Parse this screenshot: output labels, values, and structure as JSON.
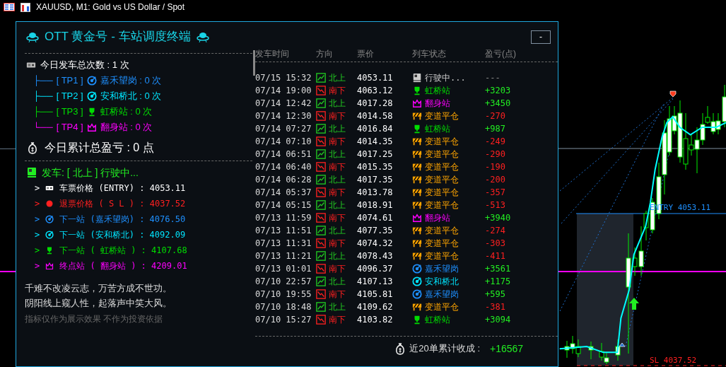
{
  "window": {
    "title": "XAUUSD, M1:  Gold vs US Dollar / Spot"
  },
  "panel": {
    "title": "OTT 黄金号 - 车站调度终端",
    "minimize": "-"
  },
  "summary": {
    "departures": "今日发车总次数 : 1 次",
    "branches": [
      {
        "tree": "├──",
        "tag": "[ TP1 ]",
        "station": "嘉禾望岗 : 0 次",
        "kind": "target",
        "color": "#1e90ff"
      },
      {
        "tree": "├──",
        "tag": "[ TP2 ]",
        "station": "安和桥北 : 0 次",
        "kind": "target",
        "color": "#00e5ff"
      },
      {
        "tree": "├──",
        "tag": "[ TP3 ]",
        "station": "虹桥站 : 0 次",
        "kind": "trophy",
        "color": "#00dd00"
      },
      {
        "tree": "└──",
        "tag": "[ TP4 ]",
        "station": "翻身站 : 0 次",
        "kind": "crown",
        "color": "#ff00ff"
      }
    ],
    "pnl": "今日累计总盈亏 : 0 点"
  },
  "current": {
    "status": "发车: [ 北上 ] 行驶中...",
    "lines": [
      {
        "marker": ">",
        "text": "车票价格 (ENTRY) : 4053.11",
        "kind": "ticket",
        "color": "#ffffff"
      },
      {
        "marker": ">",
        "text": "退票价格 ( S L ) : 4037.52",
        "kind": "dot",
        "color": "#ff2020"
      },
      {
        "marker": ">",
        "text": "下一站 (嘉禾望岗) : 4076.50",
        "kind": "target",
        "color": "#1e90ff"
      },
      {
        "marker": ">",
        "text": "下一站 (安和桥北) : 4092.09",
        "kind": "target",
        "color": "#00e5ff"
      },
      {
        "marker": ">",
        "text": "下一站 ( 虹桥站 ) : 4107.68",
        "kind": "trophy",
        "color": "#00dd00"
      },
      {
        "marker": ">",
        "text": "终点站 ( 翻身站 ) : 4209.01",
        "kind": "crown",
        "color": "#ff00ff"
      }
    ]
  },
  "quotes": [
    "千难不改凌云志，万苦方成不世功。",
    "阴阳线上窥人性，起落声中笑大风。"
  ],
  "disclaimer": "指标仅作为展示效果 不作为投资依据",
  "table": {
    "columns": [
      "发车时间",
      "方向",
      "票价",
      "列车状态",
      "盈亏(点)"
    ],
    "rows": [
      {
        "time": "07/15 15:32",
        "direction": {
          "text": "北上",
          "kind": "up"
        },
        "price": "4053.11",
        "status": {
          "text": "行驶中...",
          "kind": "running",
          "color": "#cccccc"
        },
        "pnl": {
          "text": "---",
          "color": "#888888"
        }
      },
      {
        "time": "07/14 19:00",
        "direction": {
          "text": "南下",
          "kind": "down"
        },
        "price": "4063.12",
        "status": {
          "text": "虹桥站",
          "kind": "trophy",
          "color": "#00dd00"
        },
        "pnl": {
          "text": "+3203",
          "color": "#22ee22"
        }
      },
      {
        "time": "07/14 12:42",
        "direction": {
          "text": "北上",
          "kind": "up"
        },
        "price": "4017.28",
        "status": {
          "text": "翻身站",
          "kind": "crown",
          "color": "#ff00ff"
        },
        "pnl": {
          "text": "+3450",
          "color": "#22ee22"
        }
      },
      {
        "time": "07/14 12:30",
        "direction": {
          "text": "南下",
          "kind": "down"
        },
        "price": "4014.58",
        "status": {
          "text": "变道平仓",
          "kind": "barrier",
          "color": "#ffa500"
        },
        "pnl": {
          "text": "-270",
          "color": "#ff2020"
        }
      },
      {
        "time": "07/14 07:27",
        "direction": {
          "text": "北上",
          "kind": "up"
        },
        "price": "4016.84",
        "status": {
          "text": "虹桥站",
          "kind": "trophy",
          "color": "#00dd00"
        },
        "pnl": {
          "text": "+987",
          "color": "#22ee22"
        }
      },
      {
        "time": "07/14 07:10",
        "direction": {
          "text": "南下",
          "kind": "down"
        },
        "price": "4014.35",
        "status": {
          "text": "变道平仓",
          "kind": "barrier",
          "color": "#ffa500"
        },
        "pnl": {
          "text": "-249",
          "color": "#ff2020"
        }
      },
      {
        "time": "07/14 06:51",
        "direction": {
          "text": "北上",
          "kind": "up"
        },
        "price": "4017.25",
        "status": {
          "text": "变道平仓",
          "kind": "barrier",
          "color": "#ffa500"
        },
        "pnl": {
          "text": "-290",
          "color": "#ff2020"
        }
      },
      {
        "time": "07/14 06:40",
        "direction": {
          "text": "南下",
          "kind": "down"
        },
        "price": "4015.35",
        "status": {
          "text": "变道平仓",
          "kind": "barrier",
          "color": "#ffa500"
        },
        "pnl": {
          "text": "-190",
          "color": "#ff2020"
        }
      },
      {
        "time": "07/14 06:28",
        "direction": {
          "text": "北上",
          "kind": "up"
        },
        "price": "4017.35",
        "status": {
          "text": "变道平仓",
          "kind": "barrier",
          "color": "#ffa500"
        },
        "pnl": {
          "text": "-200",
          "color": "#ff2020"
        }
      },
      {
        "time": "07/14 05:37",
        "direction": {
          "text": "南下",
          "kind": "down"
        },
        "price": "4013.78",
        "status": {
          "text": "变道平仓",
          "kind": "barrier",
          "color": "#ffa500"
        },
        "pnl": {
          "text": "-357",
          "color": "#ff2020"
        }
      },
      {
        "time": "07/14 05:15",
        "direction": {
          "text": "北上",
          "kind": "up"
        },
        "price": "4018.91",
        "status": {
          "text": "变道平仓",
          "kind": "barrier",
          "color": "#ffa500"
        },
        "pnl": {
          "text": "-513",
          "color": "#ff2020"
        }
      },
      {
        "time": "07/13 11:59",
        "direction": {
          "text": "南下",
          "kind": "down"
        },
        "price": "4074.61",
        "status": {
          "text": "翻身站",
          "kind": "crown",
          "color": "#ff00ff"
        },
        "pnl": {
          "text": "+3940",
          "color": "#22ee22"
        }
      },
      {
        "time": "07/13 11:51",
        "direction": {
          "text": "北上",
          "kind": "up"
        },
        "price": "4077.35",
        "status": {
          "text": "变道平仓",
          "kind": "barrier",
          "color": "#ffa500"
        },
        "pnl": {
          "text": "-274",
          "color": "#ff2020"
        }
      },
      {
        "time": "07/13 11:31",
        "direction": {
          "text": "南下",
          "kind": "down"
        },
        "price": "4074.32",
        "status": {
          "text": "变道平仓",
          "kind": "barrier",
          "color": "#ffa500"
        },
        "pnl": {
          "text": "-303",
          "color": "#ff2020"
        }
      },
      {
        "time": "07/13 11:21",
        "direction": {
          "text": "北上",
          "kind": "up"
        },
        "price": "4078.43",
        "status": {
          "text": "变道平仓",
          "kind": "barrier",
          "color": "#ffa500"
        },
        "pnl": {
          "text": "-411",
          "color": "#ff2020"
        }
      },
      {
        "time": "07/13 01:01",
        "direction": {
          "text": "南下",
          "kind": "down"
        },
        "price": "4096.37",
        "status": {
          "text": "嘉禾望岗",
          "kind": "target",
          "color": "#1e90ff"
        },
        "pnl": {
          "text": "+3561",
          "color": "#22ee22"
        }
      },
      {
        "time": "07/10 22:57",
        "direction": {
          "text": "北上",
          "kind": "up"
        },
        "price": "4107.13",
        "status": {
          "text": "安和桥北",
          "kind": "target",
          "color": "#00e5ff"
        },
        "pnl": {
          "text": "+1175",
          "color": "#22ee22"
        }
      },
      {
        "time": "07/10 19:55",
        "direction": {
          "text": "南下",
          "kind": "down"
        },
        "price": "4105.81",
        "status": {
          "text": "嘉禾望岗",
          "kind": "target",
          "color": "#1e90ff"
        },
        "pnl": {
          "text": "+595",
          "color": "#22ee22"
        }
      },
      {
        "time": "07/10 18:48",
        "direction": {
          "text": "北上",
          "kind": "up"
        },
        "price": "4109.62",
        "status": {
          "text": "变道平仓",
          "kind": "barrier",
          "color": "#ffa500"
        },
        "pnl": {
          "text": "-381",
          "color": "#ff2020"
        }
      },
      {
        "time": "07/10 15:27",
        "direction": {
          "text": "南下",
          "kind": "down"
        },
        "price": "4103.82",
        "status": {
          "text": "虹桥站",
          "kind": "trophy",
          "color": "#00dd00"
        },
        "pnl": {
          "text": "+3094",
          "color": "#22ee22"
        }
      }
    ],
    "footer_label": "近20单累计收成 :",
    "footer_value": "+16567"
  },
  "chart": {
    "entry_label": "ENTRY 4053.11",
    "sl_label": "SL 4037.52"
  }
}
